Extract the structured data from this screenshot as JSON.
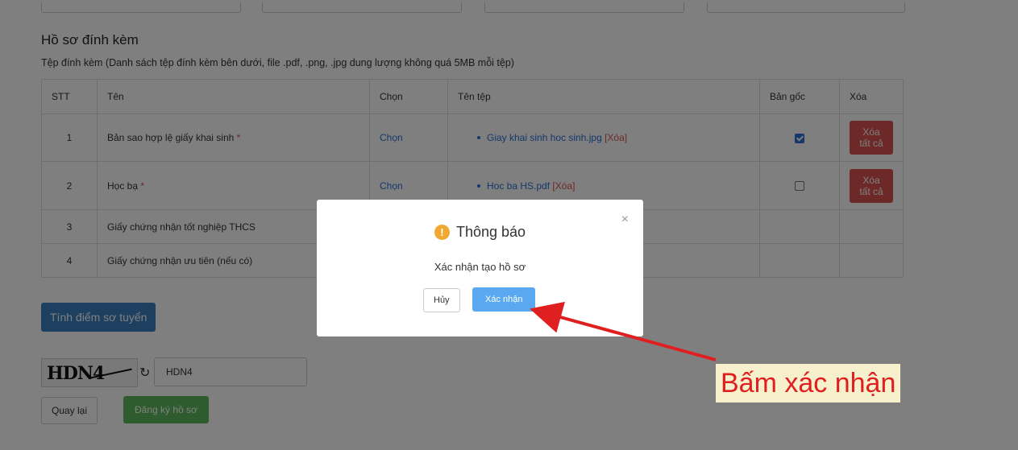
{
  "section": {
    "title": "Hồ sơ đính kèm",
    "description": "Tệp đính kèm (Danh sách tệp đính kèm bên dưới, file .pdf, .png, .jpg dung lượng không quá 5MB mỗi tệp)"
  },
  "table": {
    "headers": {
      "stt": "STT",
      "name": "Tên",
      "choose": "Chọn",
      "filename": "Tên tệp",
      "original": "Bản gốc",
      "delete": "Xóa"
    },
    "rows": [
      {
        "stt": "1",
        "name": "Bản sao hợp lệ giấy khai sinh",
        "required": "*",
        "choose": "Chọn",
        "file": "Giay khai sinh hoc sinh.jpg",
        "file_delete": "[Xóa]",
        "original_checked": true,
        "delete_all": "Xóa tất cả"
      },
      {
        "stt": "2",
        "name": "Học bạ",
        "required": "*",
        "choose": "Chọn",
        "file": "Hoc ba HS.pdf",
        "file_delete": "[Xóa]",
        "original_checked": false,
        "delete_all": "Xóa tất cả"
      },
      {
        "stt": "3",
        "name": "Giấy chứng nhận tốt nghiệp THCS"
      },
      {
        "stt": "4",
        "name": "Giấy chứng nhận ưu tiên (nếu có)"
      }
    ]
  },
  "actions": {
    "calc_score": "Tính điểm sơ tuyển",
    "captcha_image_text": "HDN4",
    "captcha_value": "HDN4",
    "back": "Quay lại",
    "register": "Đăng ký hồ sơ"
  },
  "modal": {
    "title": "Thông báo",
    "icon": "!",
    "message": "Xác nhận tạo hồ sơ",
    "cancel": "Hủy",
    "confirm": "Xác nhận",
    "close": "×"
  },
  "annotation": {
    "label": "Bấm xác nhận",
    "color": "#e02020"
  },
  "icons": {
    "refresh": "↻",
    "warning": "warning-icon",
    "close": "close-icon"
  }
}
